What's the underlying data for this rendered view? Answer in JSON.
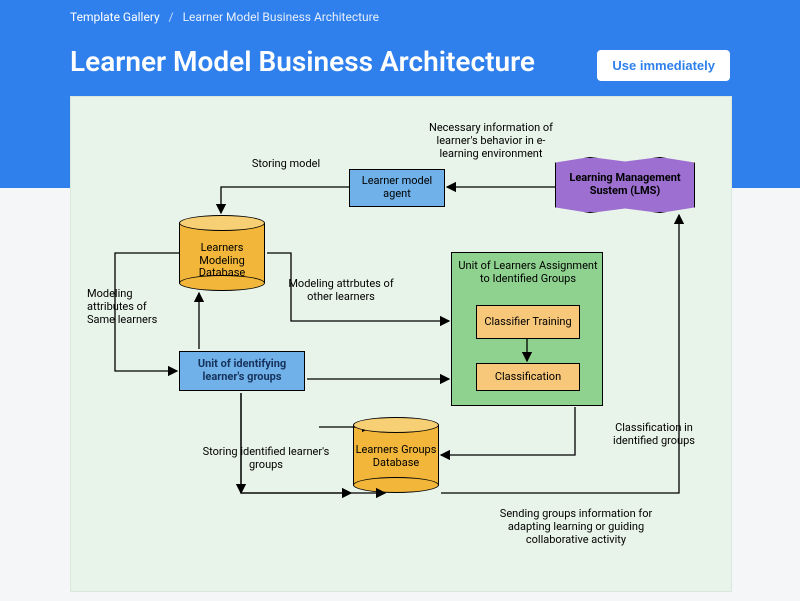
{
  "breadcrumb": {
    "root": "Template Gallery",
    "current": "Learner Model Business Architecture"
  },
  "title": "Learner Model Business Architecture",
  "use_button": "Use immediately",
  "nodes": {
    "lms": "Learning Management Sustem (LMS)",
    "agent": "Learner model agent",
    "db_model": "Learners Modeling Database",
    "unit_identify": "Unit of identifying learner's groups",
    "unit_assign_title": "Unit of Learners Assignment to Identified Groups",
    "classifier_training": "Classifier Training",
    "classification": "Classification",
    "db_groups": "Learners Groups Database"
  },
  "labels": {
    "necessary_info": "Necessary information of learner's behavior in e-learning environment",
    "storing_model": "Storing model",
    "modeling_same": "Modeling attributes of Same learners",
    "modeling_other": "Modeling attrbutes of other learners",
    "storing_identified": "Storing identified learner's groups",
    "classification_in": "Classification in identified groups",
    "sending_groups": "Sending groups information for adapting learning or guiding collaborative activity"
  }
}
